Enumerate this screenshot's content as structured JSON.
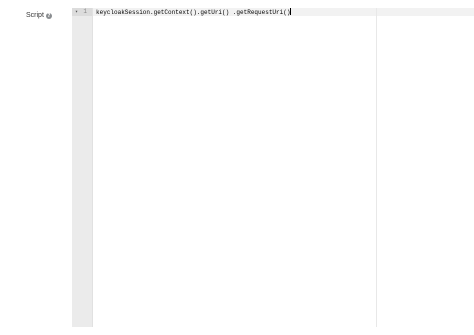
{
  "form": {
    "script_label": "Script",
    "help_icon_glyph": "?"
  },
  "editor": {
    "fold_glyph": "▾",
    "line_number": "1",
    "code": "keycloakSession.getContext().getUri() .getRequestUri()"
  }
}
